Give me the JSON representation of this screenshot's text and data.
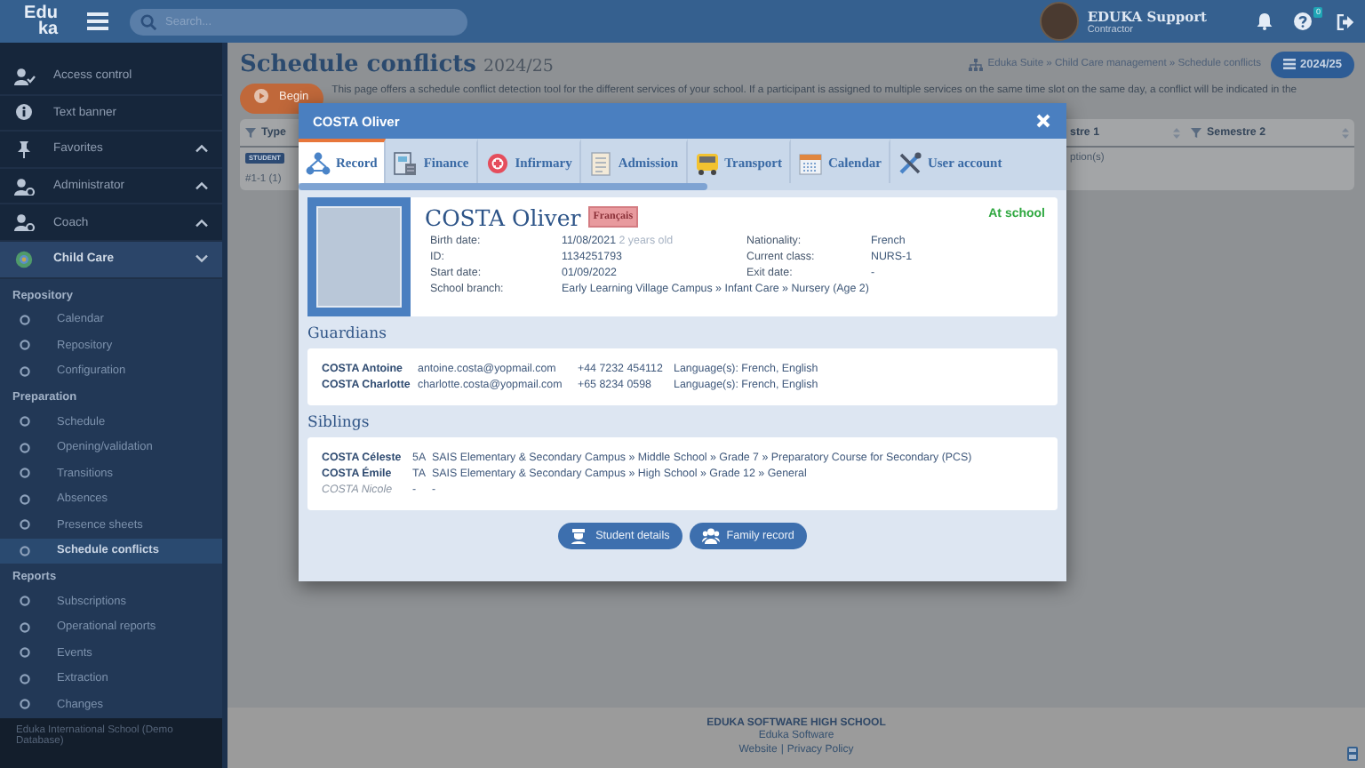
{
  "topbar": {
    "logo": [
      "Edu",
      "ka"
    ],
    "search": {
      "placeholder": "Search..."
    },
    "user": {
      "name": "EDUKA Support",
      "role": "Contractor"
    },
    "help_badge": "0"
  },
  "sidebar": {
    "items": [
      {
        "label": "Access control",
        "kind": "link",
        "selected": false
      },
      {
        "label": "Text banner",
        "kind": "link",
        "selected": false
      },
      {
        "label": "Favorites",
        "kind": "group",
        "expanded": false,
        "selected": false
      },
      {
        "label": "Administrator",
        "kind": "group",
        "expanded": false,
        "selected": false
      },
      {
        "label": "Coach",
        "kind": "group",
        "expanded": false,
        "selected": false
      },
      {
        "label": "Child Care",
        "kind": "group",
        "expanded": true,
        "selected": true
      }
    ],
    "sections": [
      {
        "title": "Repository",
        "items": [
          {
            "label": "Calendar",
            "selected": false
          },
          {
            "label": "Repository",
            "selected": false
          },
          {
            "label": "Configuration",
            "selected": false
          }
        ]
      },
      {
        "title": "Preparation",
        "items": [
          {
            "label": "Schedule",
            "selected": false
          },
          {
            "label": "Opening/validation",
            "selected": false
          },
          {
            "label": "Transitions",
            "selected": false
          },
          {
            "label": "Absences",
            "selected": false
          },
          {
            "label": "Presence sheets",
            "selected": false
          },
          {
            "label": "Schedule conflicts",
            "selected": true
          }
        ]
      },
      {
        "title": "Reports",
        "items": [
          {
            "label": "Subscriptions",
            "selected": false
          },
          {
            "label": "Operational reports",
            "selected": false
          },
          {
            "label": "Events",
            "selected": false
          },
          {
            "label": "Extraction",
            "selected": false
          },
          {
            "label": "Changes",
            "selected": false
          }
        ]
      }
    ],
    "footer": "Eduka International School (Demo Database)"
  },
  "page": {
    "title": "Schedule conflicts",
    "year": "2024/25",
    "breadcrumb": "Eduka Suite » Child Care management » Schedule conflicts",
    "year_button": "2024/25",
    "begin_button": "Begin",
    "description": "This page offers a schedule conflict detection tool for the different services of your school. If a participant is assigned to multiple services on the same time slot on the same day, a conflict will be indicated in the",
    "table": {
      "columns": [
        "Type",
        "stre 1",
        "Semestre 2"
      ],
      "rows": [
        {
          "kind": "badge",
          "type": "STUDENT",
          "column_2": "ption(s)"
        },
        {
          "kind": "text",
          "type": "#1-1 (1)"
        }
      ]
    },
    "footer": {
      "school": "EDUKA SOFTWARE HIGH SCHOOL",
      "company": "Eduka Software",
      "links": [
        "Website",
        "Privacy Policy"
      ],
      "separator": "|"
    }
  },
  "modal": {
    "title": "COSTA Oliver",
    "tabs": [
      {
        "label": "Record",
        "selected": true
      },
      {
        "label": "Finance",
        "selected": false
      },
      {
        "label": "Infirmary",
        "selected": false
      },
      {
        "label": "Admission",
        "selected": false
      },
      {
        "label": "Transport",
        "selected": false
      },
      {
        "label": "Calendar",
        "selected": false
      },
      {
        "label": "User account",
        "selected": false
      }
    ],
    "student": {
      "name": "COSTA Oliver",
      "language": "Français",
      "status": "At school",
      "fields_left": [
        {
          "label": "Birth date:",
          "value": "11/08/2021",
          "note": "2 years old"
        },
        {
          "label": "ID:",
          "value": "1134251793"
        },
        {
          "label": "Start date:",
          "value": "01/09/2022"
        },
        {
          "label": "School branch:",
          "value": "Early Learning Village Campus » Infant Care » Nursery (Age 2)"
        }
      ],
      "fields_right": [
        {
          "label": "Nationality:",
          "value": "French"
        },
        {
          "label": "Current class:",
          "value": "NURS-1"
        },
        {
          "label": "Exit date:",
          "value": "-"
        }
      ]
    },
    "guardians_title": "Guardians",
    "guardians": [
      {
        "name": "COSTA Antoine",
        "email": "antoine.costa@yopmail.com",
        "phone": "+44 7232 454112",
        "languages": "Language(s): French, English"
      },
      {
        "name": "COSTA Charlotte",
        "email": "charlotte.costa@yopmail.com",
        "phone": "+65 8234 0598",
        "languages": "Language(s): French, English"
      }
    ],
    "siblings_title": "Siblings",
    "siblings": [
      {
        "name": "COSTA Céleste",
        "class": "5A",
        "path": "SAIS Elementary & Secondary Campus » Middle School » Grade 7 » Preparatory Course for Secondary (PCS)",
        "inactive": false
      },
      {
        "name": "COSTA Émile",
        "class": "TA",
        "path": "SAIS Elementary & Secondary Campus » High School » Grade 12 » General",
        "inactive": false
      },
      {
        "name": "COSTA Nicole",
        "class": "-",
        "path": "-",
        "inactive": true
      }
    ],
    "buttons": [
      "Student details",
      "Family record"
    ]
  }
}
